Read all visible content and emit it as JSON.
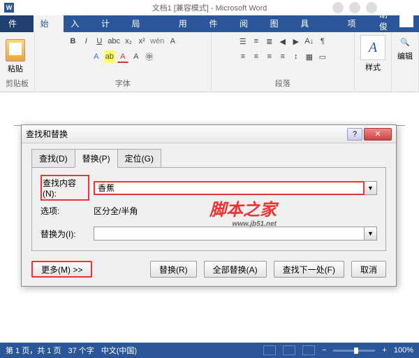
{
  "app": {
    "title": "文档1 [兼容模式] - Microsoft Word",
    "user": "胡俊"
  },
  "tabs": {
    "file": "文件",
    "home": "开始",
    "insert": "插入",
    "design": "设计",
    "layout": "页面布局",
    "references": "引用",
    "mailings": "邮件",
    "review": "审阅",
    "view": "视图",
    "developer": "开发工具",
    "addins": "加载项"
  },
  "ribbon": {
    "clipboard": {
      "label": "剪贴板",
      "paste": "粘贴"
    },
    "font": {
      "label": "字体"
    },
    "paragraph": {
      "label": "段落"
    },
    "styles": {
      "label": "样式"
    },
    "editing": {
      "label": "编辑"
    }
  },
  "dialog": {
    "title": "查找和替换",
    "tabs": {
      "find": "查找(D)",
      "replace": "替换(P)",
      "goto": "定位(G)"
    },
    "findLabel": "查找内容(N):",
    "findValue": "香蕉",
    "optionsLabel": "选项:",
    "optionsValue": "区分全/半角",
    "replaceLabel": "替换为(I):",
    "replaceValue": "",
    "buttons": {
      "more": "更多(M) >>",
      "replace": "替换(R)",
      "replaceAll": "全部替换(A)",
      "findNext": "查找下一处(F)",
      "cancel": "取消"
    }
  },
  "watermark": {
    "main": "脚本之家",
    "sub": "www.jb51.net"
  },
  "status": {
    "page": "第 1 页，共 1 页",
    "words": "37 个字",
    "lang": "中文(中国)",
    "zoom": "100%"
  }
}
